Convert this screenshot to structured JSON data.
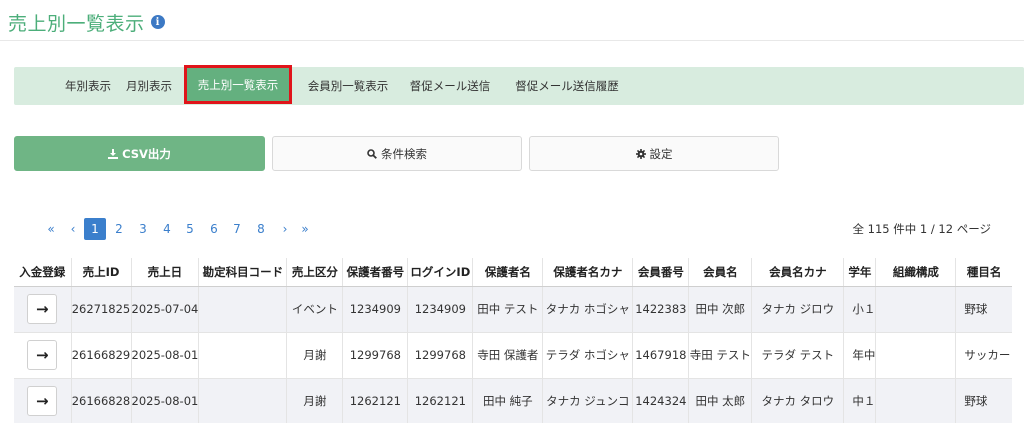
{
  "page": {
    "title": "売上別一覧表示",
    "info_icon": "i"
  },
  "tabs": [
    {
      "label": "年別表示",
      "active": false
    },
    {
      "label": "月別表示",
      "active": false
    },
    {
      "label": "売上別一覧表示",
      "active": true
    },
    {
      "label": "会員別一覧表示",
      "active": false
    },
    {
      "label": "督促メール送信",
      "active": false
    },
    {
      "label": "督促メール送信履歴",
      "active": false
    }
  ],
  "actions": {
    "csv_label": "CSV出力",
    "search_label": "条件検索",
    "settings_label": "設定"
  },
  "pagination": {
    "first": "«",
    "prev": "‹",
    "pages": [
      "1",
      "2",
      "3",
      "4",
      "5",
      "6",
      "7",
      "8"
    ],
    "current": "1",
    "next": "›",
    "last": "»",
    "summary": "全 115 件中 1 / 12 ページ"
  },
  "table": {
    "headers": [
      "入金登録",
      "売上ID",
      "売上日",
      "勘定科目コード",
      "売上区分",
      "保護者番号",
      "ログインID",
      "保護者名",
      "保護者名カナ",
      "会員番号",
      "会員名",
      "会員名カナ",
      "学年",
      "組織構成",
      "種目名"
    ],
    "rows": [
      {
        "action": "→",
        "cells": [
          "26271825",
          "2025-07-04",
          "",
          "イベント",
          "1234909",
          "1234909",
          "田中 テスト",
          "タナカ ホゴシャ",
          "1422383",
          "田中 次郎",
          "タナカ ジロウ",
          "小１",
          "",
          "野球"
        ]
      },
      {
        "action": "→",
        "cells": [
          "26166829",
          "2025-08-01",
          "",
          "月謝",
          "1299768",
          "1299768",
          "寺田 保護者",
          "テラダ ホゴシャ",
          "1467918",
          "寺田 テスト",
          "テラダ テスト",
          "年中",
          "",
          "サッカー"
        ]
      },
      {
        "action": "→",
        "cells": [
          "26166828",
          "2025-08-01",
          "",
          "月謝",
          "1262121",
          "1262121",
          "田中 純子",
          "タナカ ジュンコ",
          "1424324",
          "田中 太郎",
          "タナカ タロウ",
          "中１",
          "",
          "野球"
        ]
      }
    ]
  },
  "colors": {
    "title_green": "#4cae7a",
    "tabbar_bg": "#d8ecdf",
    "active_tab_bg": "#64b07f",
    "active_tab_border": "#e0141a",
    "csv_button": "#6fb585",
    "link_blue": "#3b7fcc",
    "row_stripe": "#f1f2f6"
  },
  "icons": {
    "info": "info-circle-icon",
    "download": "download-icon",
    "search": "search-icon",
    "settings": "gear-icon",
    "row_action": "arrow-right-icon"
  }
}
